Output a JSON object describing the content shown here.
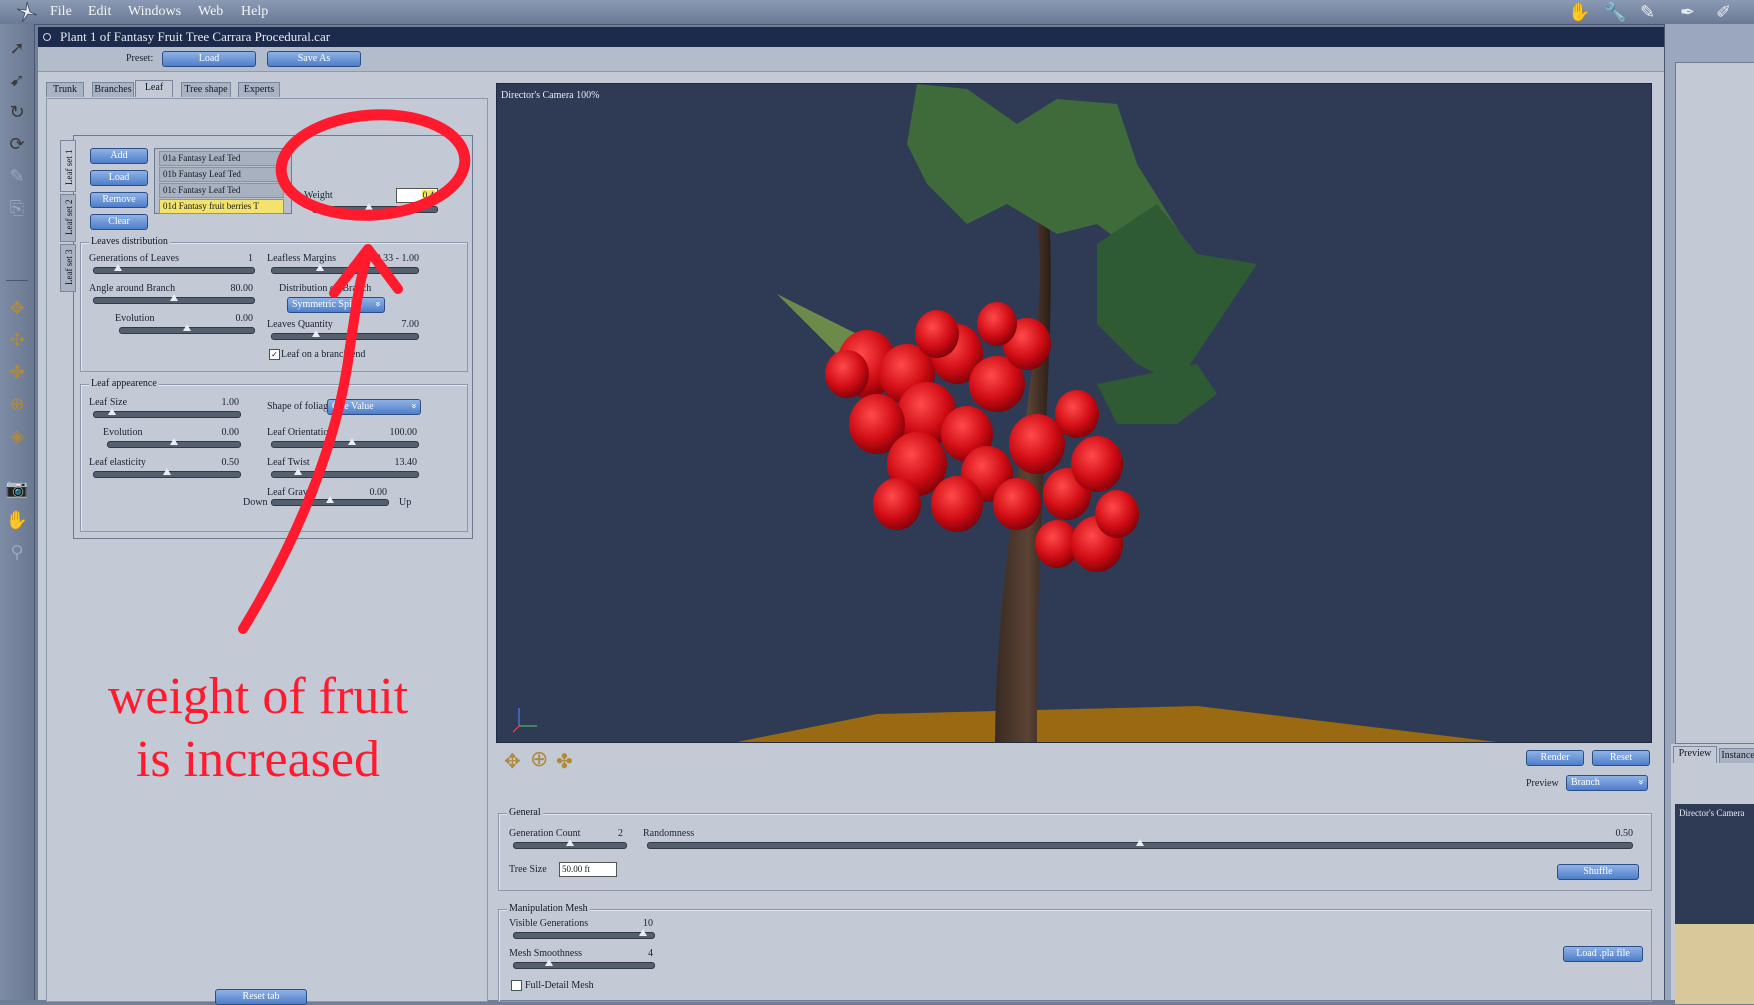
{
  "menu": [
    "File",
    "Edit",
    "Windows",
    "Web",
    "Help"
  ],
  "toolbar_icons": [
    "arrow-select-icon",
    "arrow-move-icon",
    "rotate-icon",
    "orbit-icon",
    "pencil-icon",
    "paperclip-icon",
    "move-4way-icon",
    "move-xy-icon",
    "move-xz-icon",
    "trackball-icon",
    "dolly-icon",
    "camera-icon",
    "hand-icon",
    "magnifier-icon"
  ],
  "top_right_icons": [
    "hand-tool-icon",
    "wrench-icon",
    "brush-icon",
    "pen-icon",
    "ruler-icon"
  ],
  "window": {
    "title": "Plant 1 of Fantasy Fruit Tree Carrara Procedural.car",
    "preset_label": "Preset:",
    "load_btn": "Load",
    "save_as_btn": "Save As"
  },
  "tabs": [
    "Trunk",
    "Branches",
    "Leaf",
    "Tree shape",
    "Experts"
  ],
  "active_tab": "Leaf",
  "leaf_sets": [
    "Leaf set 1",
    "Leaf set 2",
    "Leaf set 3"
  ],
  "leaf_buttons": [
    "Add",
    "Load",
    "Remove",
    "Clear"
  ],
  "leaf_list": [
    "01a Fantasy Leaf Ted",
    "01b Fantasy Leaf Ted",
    "01c Fantasy Leaf Ted",
    "01d Fantasy fruit berries T"
  ],
  "selected_leaf": 3,
  "weight": {
    "label": "Weight",
    "value": "0.4",
    "fraction": 0.45
  },
  "leaves_distribution": {
    "title": "Leaves distribution",
    "generations": {
      "label": "Generations of Leaves",
      "value": "1",
      "fraction": 0.15
    },
    "leafless": {
      "label": "Leafless Margins",
      "value": "0.33 - 1.00",
      "fraction": 0.33
    },
    "angle": {
      "label": "Angle around Branch",
      "value": "80.00",
      "fraction": 0.5
    },
    "distribution_label": "Distribution on Branch",
    "distribution_value": "Symmetric Spiral",
    "evolution": {
      "label": "Evolution",
      "value": "0.00",
      "fraction": 0.5
    },
    "quantity": {
      "label": "Leaves Quantity",
      "value": "7.00",
      "fraction": 0.3
    },
    "leaf_on_branch_end": "Leaf on a branch end"
  },
  "leaf_appearance": {
    "title": "Leaf appearence",
    "size": {
      "label": "Leaf Size",
      "value": "1.00",
      "fraction": 0.12
    },
    "shape_label": "Shape of foliage",
    "shape_value": "One Value",
    "evolution": {
      "label": "Evolution",
      "value": "0.00",
      "fraction": 0.5
    },
    "orientation": {
      "label": "Leaf Orientation",
      "value": "100.00",
      "fraction": 0.55
    },
    "elasticity": {
      "label": "Leaf elasticity",
      "value": "0.50",
      "fraction": 0.5
    },
    "twist": {
      "label": "Leaf Twist",
      "value": "13.40",
      "fraction": 0.18
    },
    "gravity": {
      "label": "Leaf Gravity",
      "value": "0.00",
      "fraction": 0.5
    },
    "down": "Down",
    "up": "Up"
  },
  "reset_tab": "Reset tab",
  "viewport": {
    "label": "Director's Camera 100%"
  },
  "nav_icons": [
    "pan-icon",
    "trackball-icon",
    "dolly-icon"
  ],
  "render_btn": "Render",
  "reset_btn": "Reset",
  "preview_label": "Preview",
  "preview_value": "Branch",
  "general": {
    "title": "General",
    "gen_count": {
      "label": "Generation Count",
      "value": "2",
      "fraction": 0.5
    },
    "randomness": {
      "label": "Randomness",
      "value": "0.50",
      "fraction": 0.5
    },
    "tree_size_label": "Tree Size",
    "tree_size_value": "50.00 ft",
    "shuffle": "Shuffle"
  },
  "manipulation": {
    "title": "Manipulation Mesh",
    "visible": {
      "label": "Visible Generations",
      "value": "10",
      "fraction": 0.92
    },
    "smooth": {
      "label": "Mesh Smoothness",
      "value": "4",
      "fraction": 0.25
    },
    "full_detail": "Full-Detail Mesh",
    "load_pla": "Load .pla file"
  },
  "right_panel": {
    "preview_tab": "Preview",
    "instances_tab": "Instances",
    "camera_label": "Director's Camera"
  },
  "annotation": {
    "line1": "weight of fruit",
    "line2": "is increased",
    "color": "#ff1a2e"
  }
}
